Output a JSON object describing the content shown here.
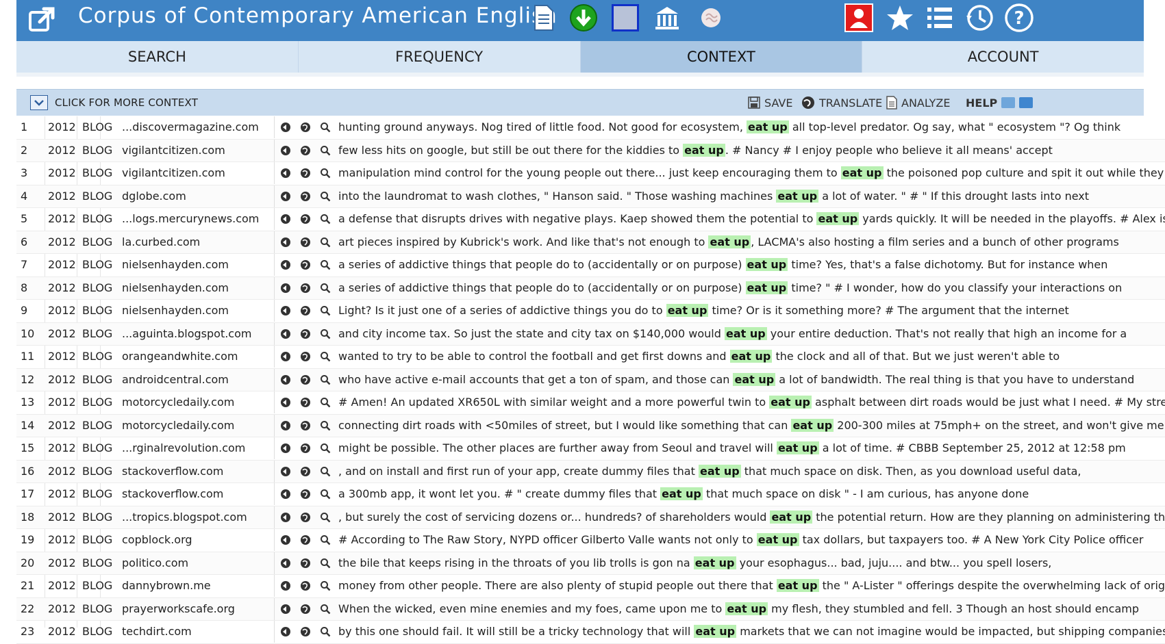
{
  "header": {
    "title": "Corpus of Contemporary American English",
    "left_icon": "external-window-icon",
    "tool_icons": [
      "document-icon",
      "download-icon",
      "grid-icon",
      "museum-icon",
      "brain-icon"
    ],
    "right_icons": [
      "user-icon",
      "star-icon",
      "list-icon",
      "history-icon",
      "help-icon"
    ]
  },
  "tabs": [
    {
      "label": "SEARCH",
      "active": false
    },
    {
      "label": "FREQUENCY",
      "active": false
    },
    {
      "label": "CONTEXT",
      "active": true
    },
    {
      "label": "ACCOUNT",
      "active": false
    }
  ],
  "toolbar": {
    "more_context": "CLICK FOR MORE CONTEXT",
    "save": "SAVE",
    "translate": "TRANSLATE",
    "analyze": "ANALYZE",
    "help": "HELP"
  },
  "rows": [
    {
      "n": "1",
      "year": "2012",
      "genre": "BLOG",
      "source": "...discovermagazine.com",
      "pre": "hunting ground anyways. Nog tired of little food. Not good for ecosystem, ",
      "kw": "eat up",
      "post": " all top-level predator. Og say, what \" ecosystem \"? Og think"
    },
    {
      "n": "2",
      "year": "2012",
      "genre": "BLOG",
      "source": "vigilantcitizen.com",
      "pre": "few less hits on google, but still be out there for the kiddies to ",
      "kw": "eat up",
      "post": ". # Nancy # I enjoy people who believe it all means' accept"
    },
    {
      "n": "3",
      "year": "2012",
      "genre": "BLOG",
      "source": "vigilantcitizen.com",
      "pre": "manipulation mind control for the young people out there... just keep encouraging them to ",
      "kw": "eat up",
      "post": " the poisoned pop culture and spit it out while they sell"
    },
    {
      "n": "4",
      "year": "2012",
      "genre": "BLOG",
      "source": "dglobe.com",
      "pre": "into the laundromat to wash clothes, \" Hanson said. \" Those washing machines ",
      "kw": "eat up",
      "post": " a lot of water. \" # \" If this drought lasts into next"
    },
    {
      "n": "5",
      "year": "2012",
      "genre": "BLOG",
      "source": "...logs.mercurynews.com",
      "pre": "a defense that disrupts drives with negative plays. Kaep showed them the potential to ",
      "kw": "eat up",
      "post": " yards quickly. It will be needed in the playoffs. # Alex is"
    },
    {
      "n": "6",
      "year": "2012",
      "genre": "BLOG",
      "source": "la.curbed.com",
      "pre": "art pieces inspired by Kubrick's work. And like that's not enough to ",
      "kw": "eat up",
      "post": ", LACMA's also hosting a film series and a bunch of other programs"
    },
    {
      "n": "7",
      "year": "2012",
      "genre": "BLOG",
      "source": "nielsenhayden.com",
      "pre": "a series of addictive things that people do to (accidentally or on purpose) ",
      "kw": "eat up",
      "post": " time? Yes, that's a false dichotomy. But for instance when"
    },
    {
      "n": "8",
      "year": "2012",
      "genre": "BLOG",
      "source": "nielsenhayden.com",
      "pre": "a series of addictive things that people do to (accidentally or on purpose) ",
      "kw": "eat up",
      "post": " time? \" # I wonder, how do you classify your interactions on"
    },
    {
      "n": "9",
      "year": "2012",
      "genre": "BLOG",
      "source": "nielsenhayden.com",
      "pre": "Light? Is it just one of a series of addictive things you do to ",
      "kw": "eat up",
      "post": " time? Or is it something more? # The argument that the internet"
    },
    {
      "n": "10",
      "year": "2012",
      "genre": "BLOG",
      "source": "...aguinta.blogspot.com",
      "pre": "and city income tax. So just the state and city tax on $140,000 would ",
      "kw": "eat up",
      "post": " your entire deduction. That's not really that high an income for a"
    },
    {
      "n": "11",
      "year": "2012",
      "genre": "BLOG",
      "source": "orangeandwhite.com",
      "pre": "wanted to try to be able to control the football and get first downs and ",
      "kw": "eat up",
      "post": " the clock and all of that. But we just weren't able to"
    },
    {
      "n": "12",
      "year": "2012",
      "genre": "BLOG",
      "source": "androidcentral.com",
      "pre": "who have active e-mail accounts that get a ton of spam, and those can ",
      "kw": "eat up",
      "post": " a lot of bandwidth. The real thing is that you have to understand"
    },
    {
      "n": "13",
      "year": "2012",
      "genre": "BLOG",
      "source": "motorcycledaily.com",
      "pre": "# Amen! An updated XR650L with similar weight and a more powerful twin to ",
      "kw": "eat up",
      "post": " asphalt between dirt roads would be just what I need. # My street"
    },
    {
      "n": "14",
      "year": "2012",
      "genre": "BLOG",
      "source": "motorcycledaily.com",
      "pre": "connecting dirt roads with <50miles of street, but I would like something that can ",
      "kw": "eat up",
      "post": " 200-300 miles at 75mph+ on the street, and won't give me a"
    },
    {
      "n": "15",
      "year": "2012",
      "genre": "BLOG",
      "source": "...rginalrevolution.com",
      "pre": "might be possible. The other places are further away from Seoul and travel will ",
      "kw": "eat up",
      "post": " a lot of time. # CBBB September 25, 2012 at 12:58 pm"
    },
    {
      "n": "16",
      "year": "2012",
      "genre": "BLOG",
      "source": "stackoverflow.com",
      "pre": ", and on install and first run of your app, create dummy files that ",
      "kw": "eat up",
      "post": " that much space on disk. Then, as you download useful data,"
    },
    {
      "n": "17",
      "year": "2012",
      "genre": "BLOG",
      "source": "stackoverflow.com",
      "pre": "a 300mb app, it wont let you. # \" create dummy files that ",
      "kw": "eat up",
      "post": " that much space on disk \" - I am curious, has anyone done"
    },
    {
      "n": "18",
      "year": "2012",
      "genre": "BLOG",
      "source": "...tropics.blogspot.com",
      "pre": ", but surely the cost of servicing dozens or... hundreds? of shareholders would ",
      "kw": "eat up",
      "post": " the potential return. How are they planning on administering this? I"
    },
    {
      "n": "19",
      "year": "2012",
      "genre": "BLOG",
      "source": "copblock.org",
      "pre": "# According to The Raw Story, NYPD officer Gilberto Valle wants not only to ",
      "kw": "eat up",
      "post": " tax dollars, but taxpayers too. # A New York City Police officer"
    },
    {
      "n": "20",
      "year": "2012",
      "genre": "BLOG",
      "source": "politico.com",
      "pre": "the bile that keeps rising in the throats of you lib trolls is gon na ",
      "kw": "eat up",
      "post": " your esophagus... bad, juju.... and btw... you spell losers,"
    },
    {
      "n": "21",
      "year": "2012",
      "genre": "BLOG",
      "source": "dannybrown.me",
      "pre": "money from other people. There are also plenty of stupid people out there that ",
      "kw": "eat up",
      "post": " the \" A-Lister \" offerings despite the overwhelming lack of originality"
    },
    {
      "n": "22",
      "year": "2012",
      "genre": "BLOG",
      "source": "prayerworkscafe.org",
      "pre": "When the wicked, even mine enemies and my foes, came upon me to ",
      "kw": "eat up",
      "post": " my flesh, they stumbled and fell. 3 Though an host should encamp"
    },
    {
      "n": "23",
      "year": "2012",
      "genre": "BLOG",
      "source": "techdirt.com",
      "pre": "by this one should fail. It will still be a tricky technology that will ",
      "kw": "eat up",
      "post": " markets that we can not imagine would be impacted, but shipping companies and"
    }
  ]
}
